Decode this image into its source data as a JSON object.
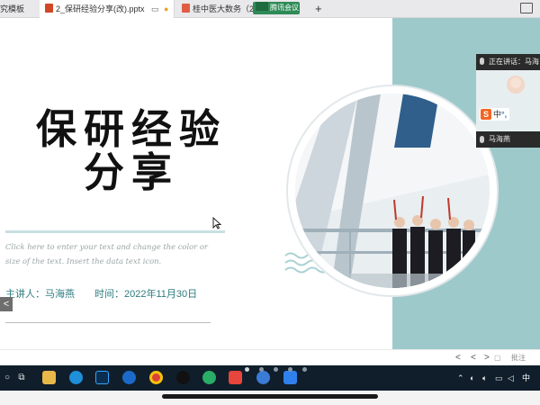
{
  "tabs": [
    {
      "label": "究模板"
    },
    {
      "label": "2_保研经验分享(改).pptx"
    },
    {
      "label": "桂中医大数务（2..."
    }
  ],
  "meeting_badge": "腾讯会议",
  "new_tab": "+",
  "slide": {
    "title_line_1": "保研经验",
    "title_line_2": "分享",
    "body_text": "Click here to enter your text and change the color or size of the text. Insert the data text icon.",
    "presenter": "主讲人：马海燕",
    "time": "时间：2022年11月30日",
    "prev_arrow": "<"
  },
  "meeting": {
    "speaking": "正在讲话：马海",
    "ime_zh": "中",
    "ime_dot": "°,",
    "participant_name": "马海燕"
  },
  "statusbar": {
    "prev": "<",
    "nav": "<",
    "next": ">",
    "notes": "批注"
  },
  "taskbar": {
    "ime_indicator": "中"
  },
  "colors": {
    "teal_band": "#9ec9cb",
    "presenter_text": "#2e7d80",
    "taskbar": "#101e2b"
  }
}
